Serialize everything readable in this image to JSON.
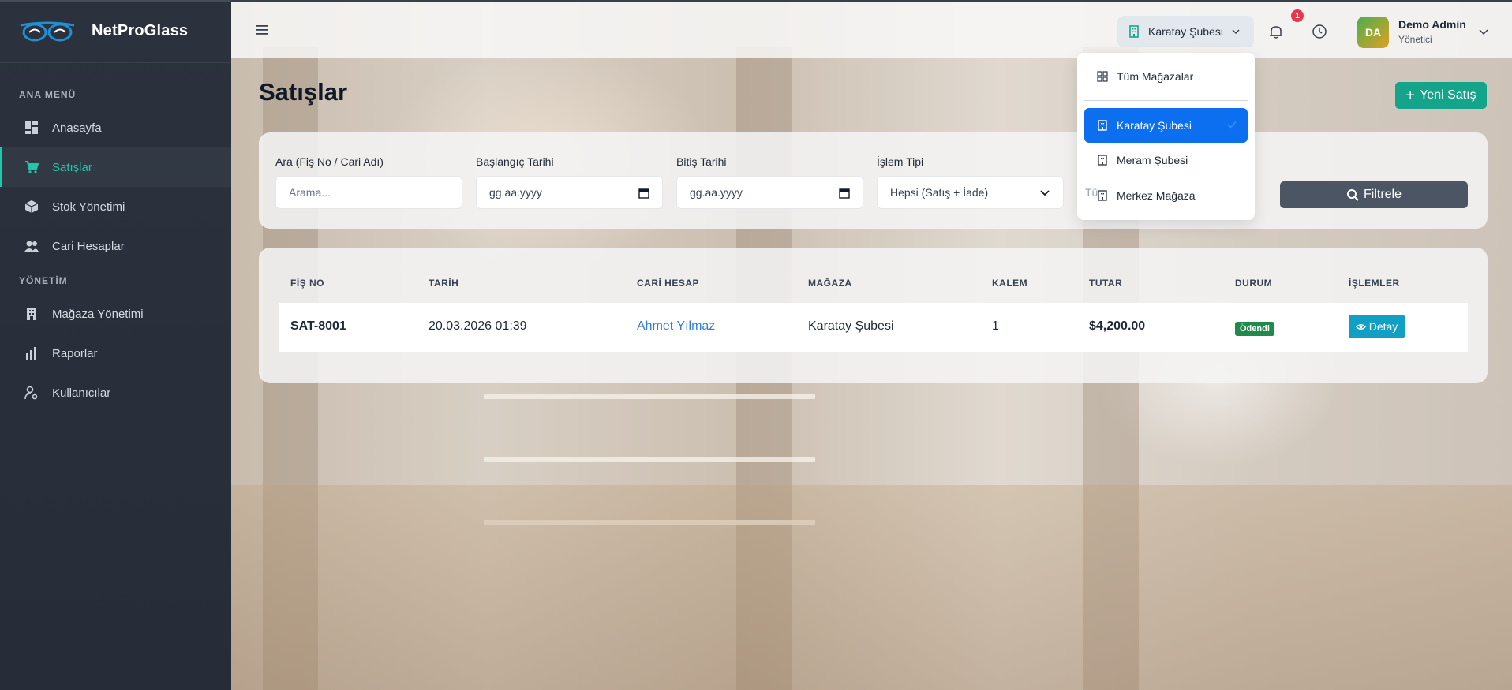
{
  "app": {
    "name": "NetProGlass"
  },
  "sidebar": {
    "section_main": "ANA MENÜ",
    "section_admin": "YÖNETİM",
    "items": [
      {
        "label": "Anasayfa",
        "icon": "dashboard-icon"
      },
      {
        "label": "Satışlar",
        "icon": "cart-icon",
        "active": true
      },
      {
        "label": "Stok Yönetimi",
        "icon": "box-icon"
      },
      {
        "label": "Cari Hesaplar",
        "icon": "users-icon"
      },
      {
        "label": "Mağaza Yönetimi",
        "icon": "building-icon"
      },
      {
        "label": "Raporlar",
        "icon": "bar-chart-icon"
      },
      {
        "label": "Kullanıcılar",
        "icon": "user-gear-icon"
      }
    ]
  },
  "topbar": {
    "store_selected": "Karatay Şubesi",
    "notification_count": "1",
    "user": {
      "initials": "DA",
      "name": "Demo Admin",
      "role": "Yönetici"
    }
  },
  "store_dropdown": {
    "items": [
      {
        "label": "Tüm Mağazalar",
        "icon": "grid-icon"
      },
      {
        "label": "Karatay Şubesi",
        "icon": "building-icon",
        "selected": true
      },
      {
        "label": "Meram Şubesi",
        "icon": "building-icon"
      },
      {
        "label": "Merkez Mağaza",
        "icon": "building-icon"
      }
    ]
  },
  "page": {
    "title": "Satışlar",
    "new_button": "Yeni Satış"
  },
  "filters": {
    "search": {
      "label": "Ara (Fiş No / Cari Adı)",
      "placeholder": "Arama..."
    },
    "start_date": {
      "label": "Başlangıç Tarihi",
      "value": "gg.aa.yyyy"
    },
    "end_date": {
      "label": "Bitiş Tarihi",
      "value": "gg.aa.yyyy"
    },
    "type": {
      "label": "İşlem Tipi",
      "value": "Hepsi (Satış + İade)"
    },
    "hidden_partial": "Tü",
    "button": "Filtrele"
  },
  "table": {
    "headers": [
      "FİŞ NO",
      "TARİH",
      "CARİ HESAP",
      "MAĞAZA",
      "KALEM",
      "TUTAR",
      "DURUM",
      "İŞLEMLER"
    ],
    "rows": [
      {
        "fis_no": "SAT-8001",
        "tarih": "20.03.2026 01:39",
        "cari": "Ahmet Yılmaz",
        "magaza": "Karatay Şubesi",
        "kalem": "1",
        "tutar": "$4,200.00",
        "durum": "Ödendi",
        "islem": "Detay"
      }
    ]
  },
  "colors": {
    "accent": "#1fc8a7",
    "primary": "#0b6ff0",
    "success": "#14a48a",
    "info": "#119fc4"
  }
}
